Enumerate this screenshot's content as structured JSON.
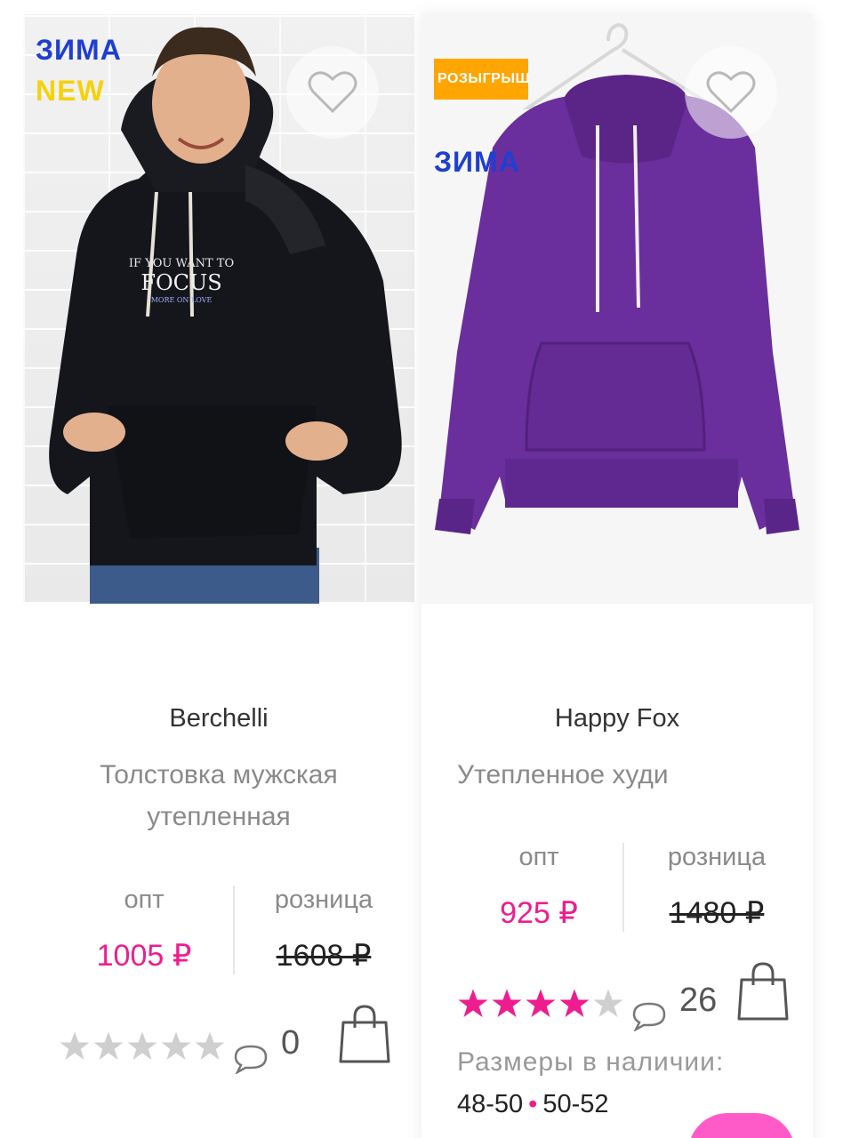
{
  "products": [
    {
      "tags": {
        "season": "ЗИМА",
        "new": "NEW"
      },
      "print_text": {
        "line1": "IF YOU WANT TO",
        "line2": "FOCUS",
        "line3": "MORE ON LOVE"
      },
      "brand": "Berchelli",
      "title_line1": "Толстовка мужская",
      "title_line2": "утепленная",
      "price": {
        "opt_label": "опт",
        "opt_value": "1005 ₽",
        "retail_label": "розница",
        "retail_value": "1608 ₽"
      },
      "rating": 0,
      "reviews": "0"
    },
    {
      "tags": {
        "raffle": "РОЗЫГРЫШ",
        "season": "ЗИМА"
      },
      "brand": "Happy Fox",
      "title_line1": "Утепленное худи",
      "price": {
        "opt_label": "опт",
        "opt_value": "925 ₽",
        "retail_label": "розница",
        "retail_value": "1480 ₽"
      },
      "rating": 4,
      "reviews": "26",
      "sizes_label": "Размеры в наличии:",
      "sizes": [
        "48-50",
        "50-52"
      ]
    }
  ],
  "colors": {
    "accent": "#ee1d8f",
    "star_empty": "#cfcfcf",
    "season_tag": "#1f3fd1",
    "new_tag": "#f5d20a",
    "raffle_tag": "#ffa500"
  },
  "icons": [
    "heart-icon",
    "star-icon",
    "comment-icon",
    "shopping-bag-icon"
  ]
}
